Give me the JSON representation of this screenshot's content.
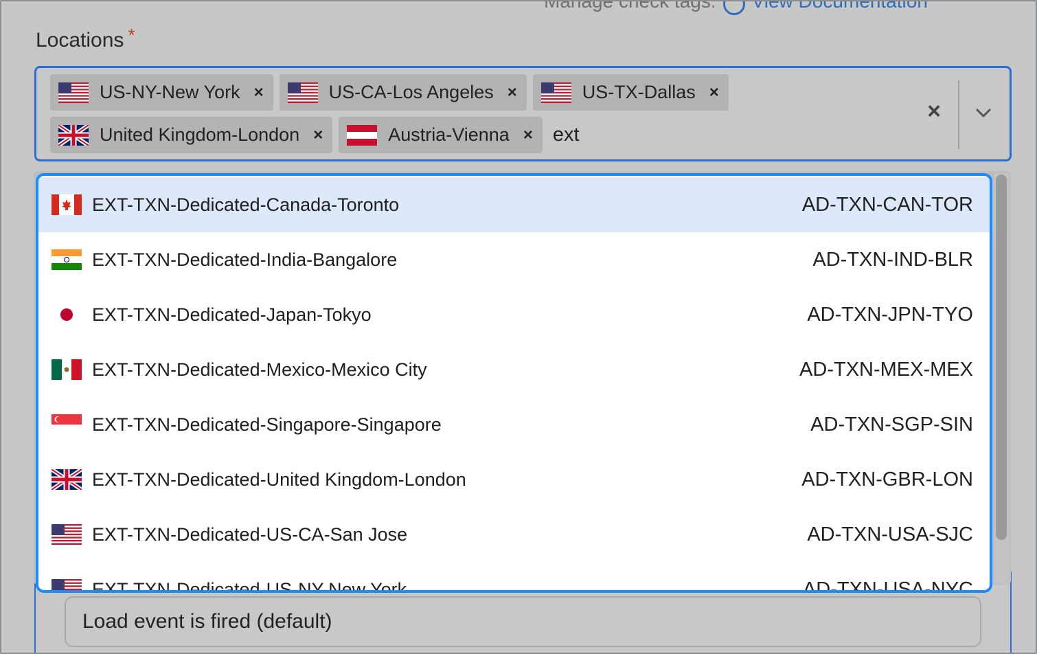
{
  "header": {
    "help_text": "Manage check tags:",
    "doc_link": "View Documentation"
  },
  "field": {
    "label": "Locations",
    "required_mark": "*"
  },
  "selected_tags": [
    {
      "label": "US-NY-New York",
      "flag": "us-flag-icon"
    },
    {
      "label": "US-CA-Los Angeles",
      "flag": "us-flag-icon"
    },
    {
      "label": "US-TX-Dallas",
      "flag": "us-flag-icon"
    },
    {
      "label": "United Kingdom-London",
      "flag": "uk-flag-icon"
    },
    {
      "label": "Austria-Vienna",
      "flag": "austria-flag-icon"
    }
  ],
  "remove_glyph": "×",
  "search": {
    "value": "ext"
  },
  "controls": {
    "clear_glyph": "×"
  },
  "options": [
    {
      "label": "EXT-TXN-Dedicated-Canada-Toronto",
      "code": "AD-TXN-CAN-TOR",
      "flag": "canada-flag-icon",
      "active": true
    },
    {
      "label": "EXT-TXN-Dedicated-India-Bangalore",
      "code": "AD-TXN-IND-BLR",
      "flag": "india-flag-icon"
    },
    {
      "label": "EXT-TXN-Dedicated-Japan-Tokyo",
      "code": "AD-TXN-JPN-TYO",
      "flag": "japan-flag-icon"
    },
    {
      "label": "EXT-TXN-Dedicated-Mexico-Mexico City",
      "code": "AD-TXN-MEX-MEX",
      "flag": "mexico-flag-icon"
    },
    {
      "label": "EXT-TXN-Dedicated-Singapore-Singapore",
      "code": "AD-TXN-SGP-SIN",
      "flag": "singapore-flag-icon"
    },
    {
      "label": "EXT-TXN-Dedicated-United Kingdom-London",
      "code": "AD-TXN-GBR-LON",
      "flag": "uk-flag-icon"
    },
    {
      "label": "EXT-TXN-Dedicated-US-CA-San Jose",
      "code": "AD-TXN-USA-SJC",
      "flag": "us-flag-icon"
    },
    {
      "label": "EXT-TXN-Dedicated-US-NY-New York",
      "code": "AD-TXN-USA-NYC",
      "flag": "us-flag-icon"
    }
  ],
  "lower": {
    "select_value": "Load event is fired (default)"
  },
  "colors": {
    "focus_border": "#1a8cff",
    "active_option": "#dde9fb",
    "overlay_bg": "#c7c7c7",
    "required": "#c0392b"
  }
}
